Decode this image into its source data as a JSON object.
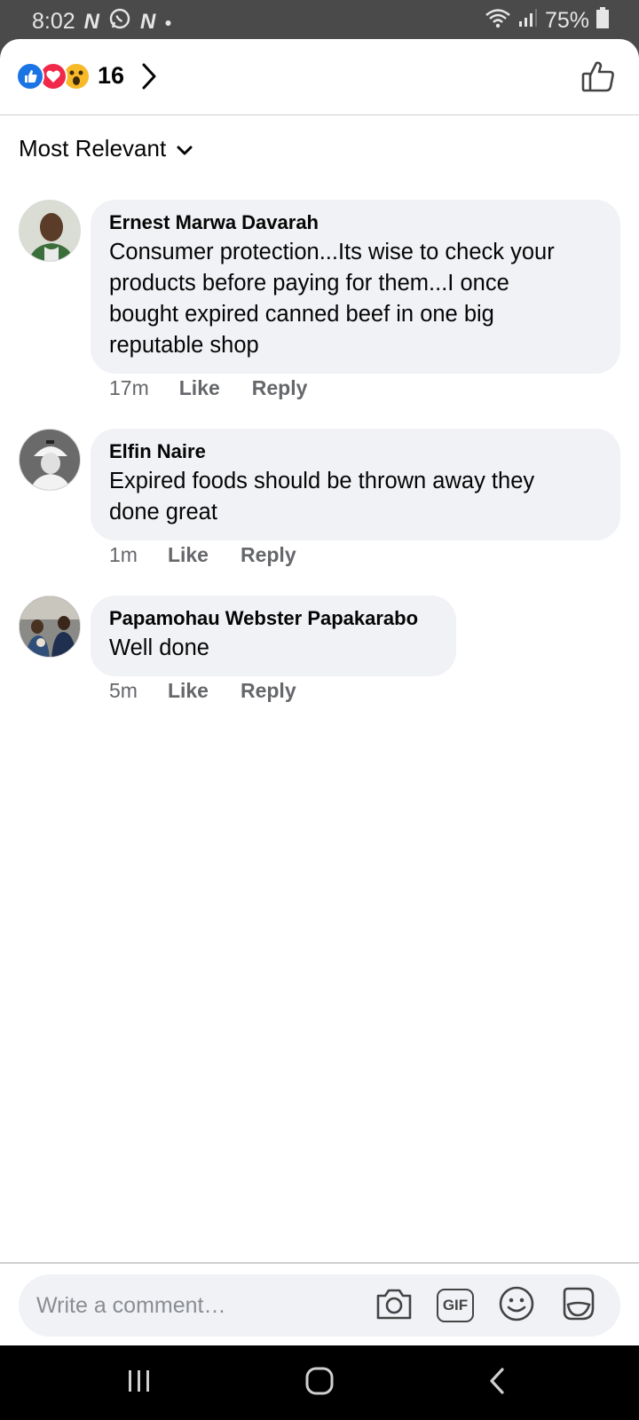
{
  "status_bar": {
    "time": "8:02",
    "battery": "75%",
    "notif_icons": [
      "n-app-icon",
      "whatsapp-icon",
      "n-app-icon",
      "dot-icon"
    ]
  },
  "reactions": {
    "count": "16",
    "icons": [
      "like-reaction-icon",
      "love-reaction-icon",
      "wow-reaction-icon"
    ]
  },
  "sort": {
    "label": "Most Relevant"
  },
  "comments": [
    {
      "author": "Ernest Marwa Davarah",
      "text_lines": [
        "Consumer protection...Its wise to check your",
        "products before paying for them...I once",
        "bought expired canned beef in one big",
        "reputable shop"
      ],
      "time": "17m",
      "like_label": "Like",
      "reply_label": "Reply"
    },
    {
      "author": "Elfin Naire",
      "text_lines": [
        "Expired foods should be thrown away they",
        "done great"
      ],
      "time": "1m",
      "like_label": "Like",
      "reply_label": "Reply"
    },
    {
      "author": "Papamohau Webster Papakarabo",
      "text_lines": [
        "Well done"
      ],
      "time": "5m",
      "like_label": "Like",
      "reply_label": "Reply"
    }
  ],
  "composer": {
    "placeholder": "Write a comment…",
    "gif_label": "GIF"
  },
  "colors": {
    "like_blue": "#1b74e4",
    "love_red": "#f02849",
    "wow_yellow": "#f7b928",
    "bubble_bg": "#f0f2f5",
    "meta_gray": "#65676b"
  }
}
